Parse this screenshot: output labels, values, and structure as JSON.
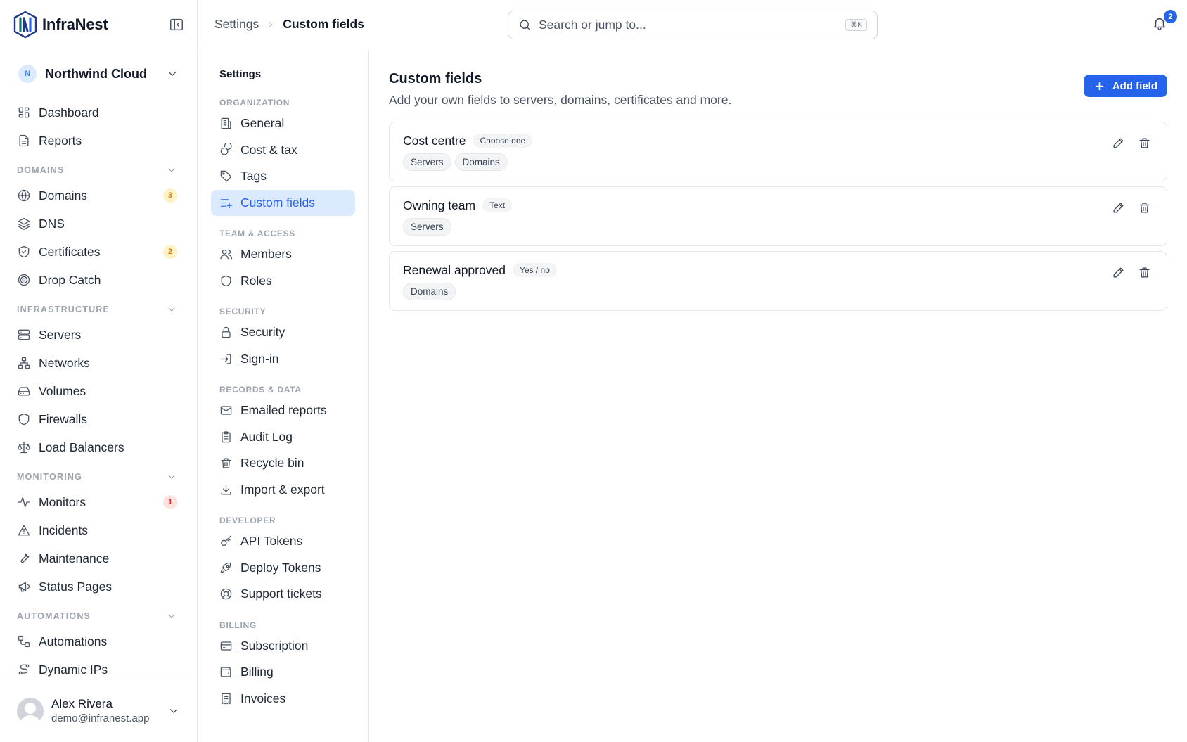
{
  "brand": {
    "name": "InfraNest"
  },
  "org": {
    "initial": "N",
    "name": "Northwind Cloud"
  },
  "nav": {
    "top": [
      {
        "label": "Dashboard",
        "icon": "dashboard-icon"
      },
      {
        "label": "Reports",
        "icon": "reports-icon"
      }
    ],
    "sections": [
      {
        "title": "DOMAINS",
        "items": [
          {
            "label": "Domains",
            "icon": "globe-icon",
            "badge": "3",
            "badge_color": "amber"
          },
          {
            "label": "DNS",
            "icon": "layers-icon"
          },
          {
            "label": "Certificates",
            "icon": "shield-check-icon",
            "badge": "2",
            "badge_color": "amber"
          },
          {
            "label": "Drop Catch",
            "icon": "target-icon"
          }
        ]
      },
      {
        "title": "INFRASTRUCTURE",
        "items": [
          {
            "label": "Servers",
            "icon": "server-icon"
          },
          {
            "label": "Networks",
            "icon": "network-icon"
          },
          {
            "label": "Volumes",
            "icon": "drive-icon"
          },
          {
            "label": "Firewalls",
            "icon": "shield-icon"
          },
          {
            "label": "Load Balancers",
            "icon": "scale-icon"
          }
        ]
      },
      {
        "title": "MONITORING",
        "items": [
          {
            "label": "Monitors",
            "icon": "activity-icon",
            "badge": "1",
            "badge_color": "red"
          },
          {
            "label": "Incidents",
            "icon": "alert-icon"
          },
          {
            "label": "Maintenance",
            "icon": "wrench-icon"
          },
          {
            "label": "Status Pages",
            "icon": "megaphone-icon"
          }
        ]
      },
      {
        "title": "AUTOMATIONS",
        "items": [
          {
            "label": "Automations",
            "icon": "workflow-icon"
          },
          {
            "label": "Dynamic IPs",
            "icon": "route-icon"
          }
        ]
      }
    ]
  },
  "user": {
    "name": "Alex Rivera",
    "email": "demo@infranest.app"
  },
  "header": {
    "breadcrumb_parent": "Settings",
    "breadcrumb_current": "Custom fields",
    "search_placeholder": "Search or jump to...",
    "search_shortcut": "⌘K",
    "notifications_count": "2"
  },
  "subnav": {
    "title": "Settings",
    "groups": [
      {
        "title": "ORGANIZATION",
        "items": [
          {
            "label": "General",
            "icon": "building-icon"
          },
          {
            "label": "Cost & tax",
            "icon": "coins-icon"
          },
          {
            "label": "Tags",
            "icon": "tag-icon"
          },
          {
            "label": "Custom fields",
            "icon": "list-plus-icon",
            "active": true
          }
        ]
      },
      {
        "title": "TEAM & ACCESS",
        "items": [
          {
            "label": "Members",
            "icon": "users-icon"
          },
          {
            "label": "Roles",
            "icon": "shield-icon"
          }
        ]
      },
      {
        "title": "SECURITY",
        "items": [
          {
            "label": "Security",
            "icon": "lock-icon"
          },
          {
            "label": "Sign-in",
            "icon": "sign-in-icon"
          }
        ]
      },
      {
        "title": "RECORDS & DATA",
        "items": [
          {
            "label": "Emailed reports",
            "icon": "mail-icon"
          },
          {
            "label": "Audit Log",
            "icon": "clipboard-icon"
          },
          {
            "label": "Recycle bin",
            "icon": "trash-icon"
          },
          {
            "label": "Import & export",
            "icon": "download-icon"
          }
        ]
      },
      {
        "title": "DEVELOPER",
        "items": [
          {
            "label": "API Tokens",
            "icon": "key-icon"
          },
          {
            "label": "Deploy Tokens",
            "icon": "rocket-icon"
          },
          {
            "label": "Support tickets",
            "icon": "lifebuoy-icon"
          }
        ]
      },
      {
        "title": "BILLING",
        "items": [
          {
            "label": "Subscription",
            "icon": "credit-card-icon"
          },
          {
            "label": "Billing",
            "icon": "wallet-icon"
          },
          {
            "label": "Invoices",
            "icon": "receipt-icon"
          }
        ]
      }
    ]
  },
  "main": {
    "title": "Custom fields",
    "subtitle": "Add your own fields to servers, domains, certificates and more.",
    "add_button": "Add field",
    "fields": [
      {
        "name": "Cost centre",
        "type": "Choose one",
        "applies_to": [
          "Servers",
          "Domains"
        ]
      },
      {
        "name": "Owning team",
        "type": "Text",
        "applies_to": [
          "Servers"
        ]
      },
      {
        "name": "Renewal approved",
        "type": "Yes / no",
        "applies_to": [
          "Domains"
        ]
      }
    ]
  },
  "colors": {
    "accent": "#2563eb",
    "active_bg": "#dbeafe",
    "border": "#e5e7eb"
  }
}
